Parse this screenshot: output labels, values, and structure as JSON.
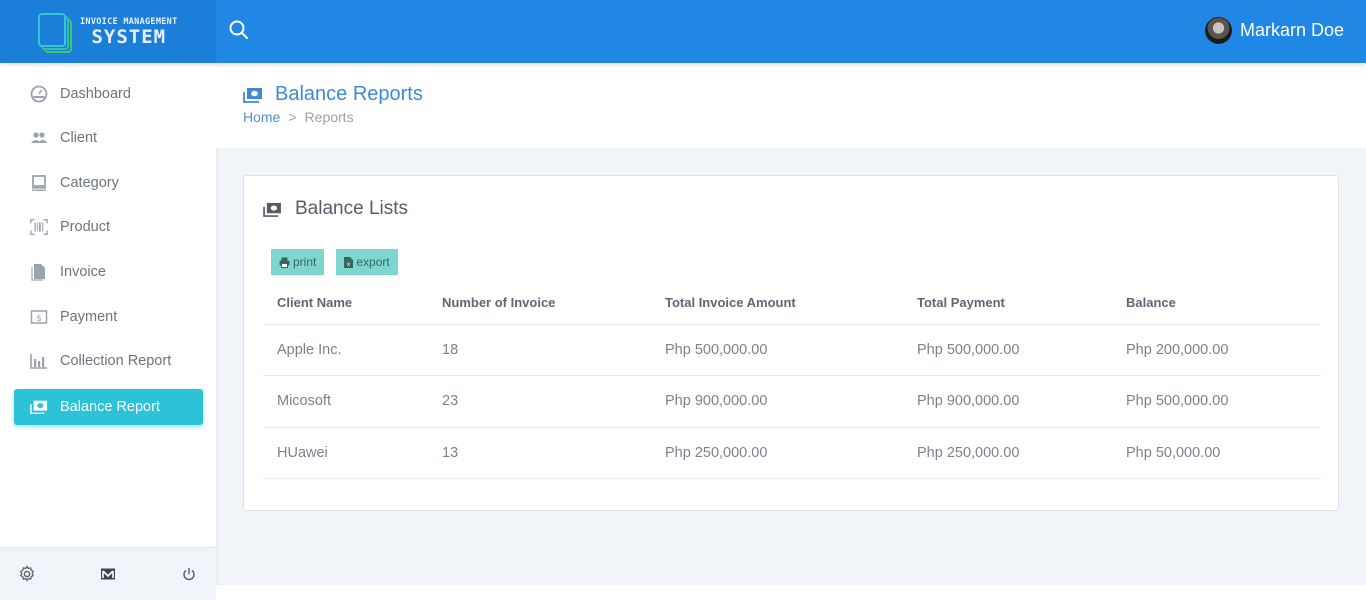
{
  "app": {
    "brand_line1": "INVOICE MANAGEMENT",
    "brand_line2": "SYSTEM",
    "search_icon": "search-icon",
    "user_name": "Markarn Doe"
  },
  "sidebar": {
    "items": [
      {
        "label": "Dashboard",
        "icon": "dashboard-gauge-icon",
        "active": false
      },
      {
        "label": "Client",
        "icon": "users-icon",
        "active": false
      },
      {
        "label": "Category",
        "icon": "laptop-icon",
        "active": false
      },
      {
        "label": "Product",
        "icon": "barcode-icon",
        "active": false
      },
      {
        "label": "Invoice",
        "icon": "file-icon",
        "active": false
      },
      {
        "label": "Payment",
        "icon": "money-bill-icon",
        "active": false
      },
      {
        "label": "Collection Report",
        "icon": "bar-chart-icon",
        "active": false
      },
      {
        "label": "Balance Report",
        "icon": "money-stack-icon",
        "active": true
      }
    ],
    "footer": [
      "settings-gear-icon",
      "mail-icon",
      "power-icon"
    ]
  },
  "header": {
    "title": "Balance Reports",
    "breadcrumb": {
      "home": "Home",
      "separator": ">",
      "current": "Reports"
    }
  },
  "card": {
    "title": "Balance Lists",
    "buttons": {
      "print": "print",
      "export": "export"
    },
    "table": {
      "columns": [
        "Client Name",
        "Number of Invoice",
        "Total Invoice Amount",
        "Total Payment",
        "Balance"
      ],
      "rows": [
        [
          "Apple Inc.",
          "18",
          "Php 500,000.00",
          "Php 500,000.00",
          "Php 200,000.00"
        ],
        [
          "Micosoft",
          "23",
          "Php 900,000.00",
          "Php 900,000.00",
          "Php 500,000.00"
        ],
        [
          "HUawei",
          "13",
          "Php 250,000.00",
          "Php 250,000.00",
          "Php 50,000.00"
        ]
      ]
    }
  },
  "colors": {
    "topbar": "#2087e4",
    "accent_active": "#2cc3d8",
    "button": "#7dd6d0",
    "title_blue": "#3d8ad6"
  }
}
